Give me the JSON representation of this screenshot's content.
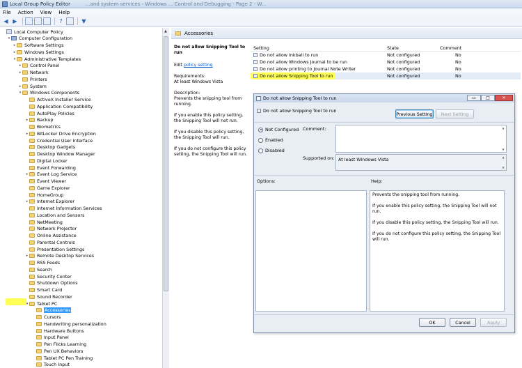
{
  "window": {
    "title": "Local Group Policy Editor",
    "ghost_tab": "...and system services - Windows ... Control and Debugging - Page 2 - W..."
  },
  "menu": [
    "File",
    "Action",
    "View",
    "Help"
  ],
  "tree": {
    "items": [
      {
        "label": "Local Computer Policy",
        "level": 0,
        "icon": "policy-root-icon",
        "arrow": ""
      },
      {
        "label": "Computer Configuration",
        "level": 1,
        "icon": "computer-icon",
        "arrow": "▾"
      },
      {
        "label": "Software Settings",
        "level": 2,
        "icon": "folder-icon",
        "arrow": "▸"
      },
      {
        "label": "Windows Settings",
        "level": 2,
        "icon": "folder-icon",
        "arrow": "▸"
      },
      {
        "label": "Administrative Templates",
        "level": 2,
        "icon": "folder-icon",
        "arrow": "▾"
      },
      {
        "label": "Control Panel",
        "level": 3,
        "icon": "folder-icon",
        "arrow": "▸"
      },
      {
        "label": "Network",
        "level": 3,
        "icon": "folder-icon",
        "arrow": "▸"
      },
      {
        "label": "Printers",
        "level": 3,
        "icon": "folder-icon",
        "arrow": ""
      },
      {
        "label": "System",
        "level": 3,
        "icon": "folder-icon",
        "arrow": "▸"
      },
      {
        "label": "Windows Components",
        "level": 3,
        "icon": "folder-icon",
        "arrow": "▾"
      },
      {
        "label": "ActiveX Installer Service",
        "level": 4,
        "icon": "folder-icon",
        "arrow": ""
      },
      {
        "label": "Application Compatibility",
        "level": 4,
        "icon": "folder-icon",
        "arrow": ""
      },
      {
        "label": "AutoPlay Policies",
        "level": 4,
        "icon": "folder-icon",
        "arrow": ""
      },
      {
        "label": "Backup",
        "level": 4,
        "icon": "folder-icon",
        "arrow": "▸"
      },
      {
        "label": "Biometrics",
        "level": 4,
        "icon": "folder-icon",
        "arrow": ""
      },
      {
        "label": "BitLocker Drive Encryption",
        "level": 4,
        "icon": "folder-icon",
        "arrow": "▸"
      },
      {
        "label": "Credential User Interface",
        "level": 4,
        "icon": "folder-icon",
        "arrow": ""
      },
      {
        "label": "Desktop Gadgets",
        "level": 4,
        "icon": "folder-icon",
        "arrow": ""
      },
      {
        "label": "Desktop Window Manager",
        "level": 4,
        "icon": "folder-icon",
        "arrow": ""
      },
      {
        "label": "Digital Locker",
        "level": 4,
        "icon": "folder-icon",
        "arrow": ""
      },
      {
        "label": "Event Forwarding",
        "level": 4,
        "icon": "folder-icon",
        "arrow": ""
      },
      {
        "label": "Event Log Service",
        "level": 4,
        "icon": "folder-icon",
        "arrow": "▸"
      },
      {
        "label": "Event Viewer",
        "level": 4,
        "icon": "folder-icon",
        "arrow": ""
      },
      {
        "label": "Game Explorer",
        "level": 4,
        "icon": "folder-icon",
        "arrow": ""
      },
      {
        "label": "HomeGroup",
        "level": 4,
        "icon": "folder-icon",
        "arrow": ""
      },
      {
        "label": "Internet Explorer",
        "level": 4,
        "icon": "folder-icon",
        "arrow": "▸"
      },
      {
        "label": "Internet Information Services",
        "level": 4,
        "icon": "folder-icon",
        "arrow": ""
      },
      {
        "label": "Location and Sensors",
        "level": 4,
        "icon": "folder-icon",
        "arrow": ""
      },
      {
        "label": "NetMeeting",
        "level": 4,
        "icon": "folder-icon",
        "arrow": ""
      },
      {
        "label": "Network Projector",
        "level": 4,
        "icon": "folder-icon",
        "arrow": ""
      },
      {
        "label": "Online Assistance",
        "level": 4,
        "icon": "folder-icon",
        "arrow": ""
      },
      {
        "label": "Parental Controls",
        "level": 4,
        "icon": "folder-icon",
        "arrow": ""
      },
      {
        "label": "Presentation Settings",
        "level": 4,
        "icon": "folder-icon",
        "arrow": ""
      },
      {
        "label": "Remote Desktop Services",
        "level": 4,
        "icon": "folder-icon",
        "arrow": "▸"
      },
      {
        "label": "RSS Feeds",
        "level": 4,
        "icon": "folder-icon",
        "arrow": ""
      },
      {
        "label": "Search",
        "level": 4,
        "icon": "folder-icon",
        "arrow": ""
      },
      {
        "label": "Security Center",
        "level": 4,
        "icon": "folder-icon",
        "arrow": ""
      },
      {
        "label": "Shutdown Options",
        "level": 4,
        "icon": "folder-icon",
        "arrow": ""
      },
      {
        "label": "Smart Card",
        "level": 4,
        "icon": "folder-icon",
        "arrow": ""
      },
      {
        "label": "Sound Recorder",
        "level": 4,
        "icon": "folder-icon",
        "arrow": ""
      },
      {
        "label": "Tablet PC",
        "level": 4,
        "icon": "folder-icon",
        "arrow": "▾"
      },
      {
        "label": "Accessories",
        "level": 5,
        "icon": "folder-icon",
        "arrow": "",
        "selected": true
      },
      {
        "label": "Cursors",
        "level": 5,
        "icon": "folder-icon",
        "arrow": ""
      },
      {
        "label": "Handwriting personalization",
        "level": 5,
        "icon": "folder-icon",
        "arrow": ""
      },
      {
        "label": "Hardware Buttons",
        "level": 5,
        "icon": "folder-icon",
        "arrow": ""
      },
      {
        "label": "Input Panel",
        "level": 5,
        "icon": "folder-icon",
        "arrow": ""
      },
      {
        "label": "Pen Flicks Learning",
        "level": 5,
        "icon": "folder-icon",
        "arrow": ""
      },
      {
        "label": "Pen UX Behaviors",
        "level": 5,
        "icon": "folder-icon",
        "arrow": ""
      },
      {
        "label": "Tablet PC Pen Training",
        "level": 5,
        "icon": "folder-icon",
        "arrow": ""
      },
      {
        "label": "Touch Input",
        "level": 5,
        "icon": "folder-icon",
        "arrow": ""
      }
    ]
  },
  "right": {
    "header": "Accessories",
    "description": {
      "title": "Do not allow Snipping Tool to run",
      "edit_prefix": "Edit",
      "edit_link": "policy setting",
      "requirements_label": "Requirements:",
      "requirements_value": "At least Windows Vista",
      "description_label": "Description:",
      "paragraphs": [
        "Prevents the snipping tool from running.",
        "If you enable this policy setting, the Snipping Tool will not run.",
        "If you disable this policy setting, the Snipping Tool will run.",
        "If you do not configure this policy setting, the Snipping Tool will run."
      ]
    },
    "list": {
      "columns": [
        "Setting",
        "State",
        "Comment"
      ],
      "rows": [
        {
          "setting": "Do not allow Inkball to run",
          "state": "Not configured",
          "comment": "No"
        },
        {
          "setting": "Do not allow Windows Journal to be run",
          "state": "Not configured",
          "comment": "No"
        },
        {
          "setting": "Do not allow printing to Journal Note Writer",
          "state": "Not configured",
          "comment": "No"
        },
        {
          "setting": "Do not allow Snipping Tool to run",
          "state": "Not configured",
          "comment": "No"
        }
      ]
    }
  },
  "dialog": {
    "title": "Do not allow Snipping Tool to run",
    "header_label": "Do not allow Snipping Tool to run",
    "prev_button": "Previous Setting",
    "next_button": "Next Setting",
    "radio": {
      "not_configured": "Not Configured",
      "enabled": "Enabled",
      "disabled": "Disabled"
    },
    "comment_label": "Comment:",
    "supported_label": "Supported on:",
    "supported_value": "At least Windows Vista",
    "options_label": "Options:",
    "help_label": "Help:",
    "help": [
      "Prevents the snipping tool from running.",
      "If you enable this policy setting, the Snipping Tool will not run.",
      "If you disable this policy setting, the Snipping Tool will run.",
      "If you do not configure this policy setting, the Snipping Tool will run."
    ],
    "ok": "OK",
    "cancel": "Cancel",
    "apply": "Apply"
  },
  "colors": {
    "highlight": "#ffff55",
    "selection": "#3399ff",
    "link": "#0b55c4"
  }
}
